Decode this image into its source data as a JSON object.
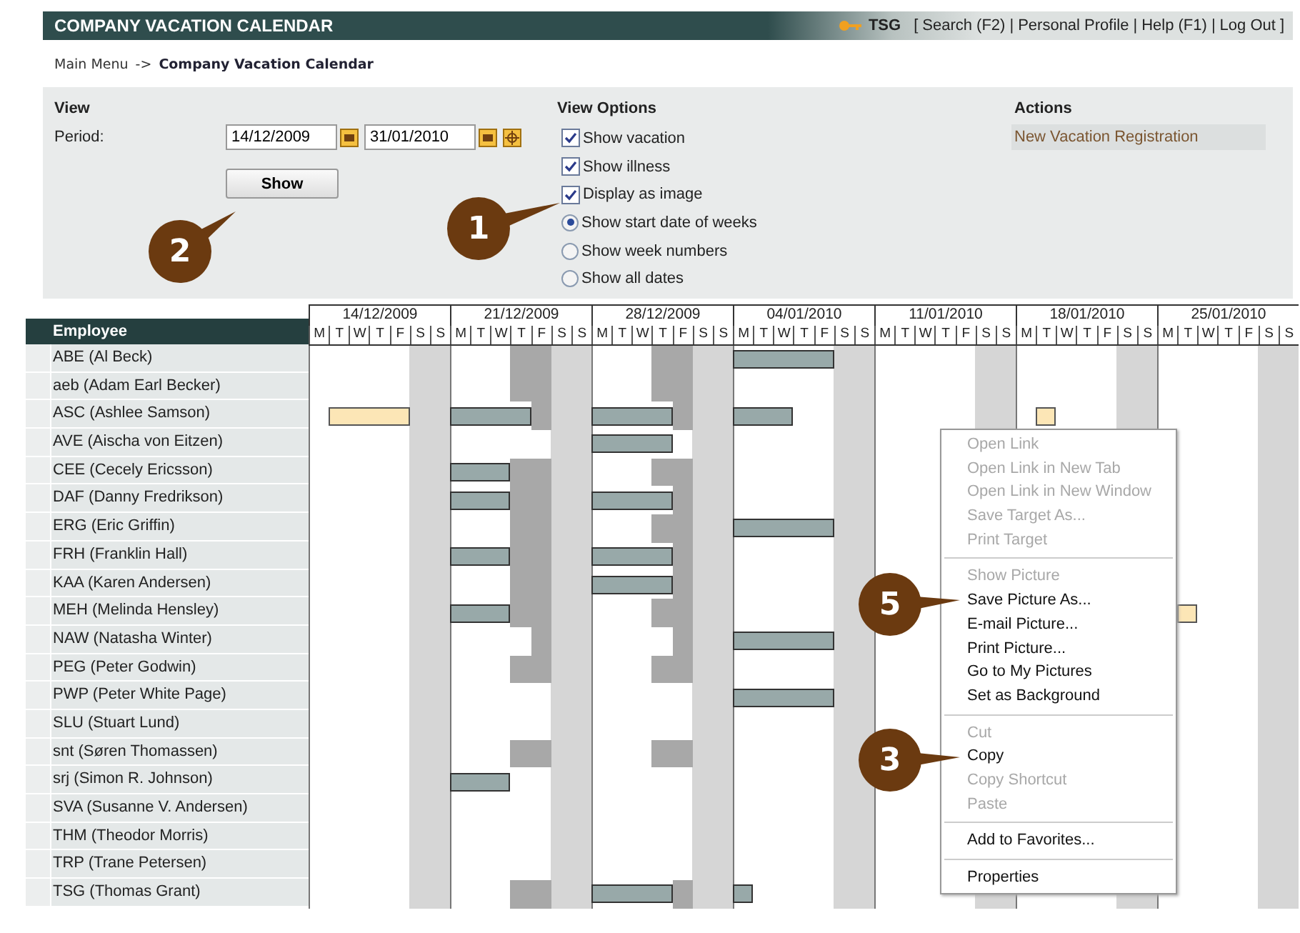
{
  "header": {
    "title": "COMPANY VACATION CALENDAR",
    "user": "TSG",
    "open": "[",
    "close": "]",
    "separator": "|",
    "links": [
      "Search (F2)",
      "Personal Profile",
      "Help (F1)",
      "Log Out"
    ]
  },
  "breadcrumb": {
    "parent": "Main Menu",
    "arrow": "->",
    "current": "Company Vacation Calendar"
  },
  "view": {
    "heading": "View",
    "period_label": "Period:",
    "from": "14/12/2009",
    "to": "31/01/2010",
    "show_button": "Show"
  },
  "view_options": {
    "heading": "View Options",
    "checkboxes": [
      {
        "label": "Show vacation",
        "checked": true
      },
      {
        "label": "Show illness",
        "checked": true
      },
      {
        "label": "Display as image",
        "checked": true
      }
    ],
    "radios": [
      {
        "label": "Show start date of weeks",
        "selected": true
      },
      {
        "label": "Show week numbers",
        "selected": false
      },
      {
        "label": "Show all dates",
        "selected": false
      }
    ]
  },
  "actions": {
    "heading": "Actions",
    "items": [
      "New Vacation Registration"
    ]
  },
  "calendar": {
    "employee_heading": "Employee",
    "weeks": [
      {
        "date": "14/12/2009",
        "days": [
          "M",
          "T",
          "W",
          "T",
          "F",
          "S",
          "S"
        ]
      },
      {
        "date": "21/12/2009",
        "days": [
          "M",
          "T",
          "W",
          "T",
          "F",
          "S",
          "S"
        ]
      },
      {
        "date": "28/12/2009",
        "days": [
          "M",
          "T",
          "W",
          "T",
          "F",
          "S",
          "S"
        ]
      },
      {
        "date": "04/01/2010",
        "days": [
          "M",
          "T",
          "W",
          "T",
          "F",
          "S",
          "S"
        ]
      },
      {
        "date": "11/01/2010",
        "days": [
          "M",
          "T",
          "W",
          "T",
          "F",
          "S",
          "S"
        ]
      },
      {
        "date": "18/01/2010",
        "days": [
          "M",
          "T",
          "W",
          "T",
          "F",
          "S",
          "S"
        ]
      },
      {
        "date": "25/01/2010",
        "days": [
          "M",
          "T",
          "W",
          "T",
          "F",
          "S",
          "S"
        ]
      }
    ],
    "rows": [
      {
        "name": "ABE (Al Beck)"
      },
      {
        "name": "aeb (Adam Earl Becker)"
      },
      {
        "name": "ASC (Ashlee Samson)"
      },
      {
        "name": "AVE (Aischa von Eitzen)"
      },
      {
        "name": "CEE (Cecely Ericsson)"
      },
      {
        "name": "DAF (Danny Fredrikson)"
      },
      {
        "name": "ERG (Eric Griffin)"
      },
      {
        "name": "FRH (Franklin Hall)"
      },
      {
        "name": "KAA (Karen Andersen)"
      },
      {
        "name": "MEH (Melinda Hensley)"
      },
      {
        "name": "NAW (Natasha Winter)"
      },
      {
        "name": "PEG (Peter Godwin)"
      },
      {
        "name": "PWP (Peter White Page)"
      },
      {
        "name": "SLU (Stuart Lund)"
      },
      {
        "name": "snt (Søren Thomassen)"
      },
      {
        "name": "srj (Simon R. Johnson)"
      },
      {
        "name": "SVA (Susanne V. Andersen)"
      },
      {
        "name": "THM (Theodor Morris)"
      },
      {
        "name": "TRP (Trane Petersen)"
      },
      {
        "name": "TSG (Thomas Grant)"
      }
    ]
  },
  "context_menu": {
    "groups": [
      [
        {
          "label": "Open Link",
          "disabled": true
        },
        {
          "label": "Open Link in New Tab",
          "disabled": true
        },
        {
          "label": "Open Link in New Window",
          "disabled": true
        },
        {
          "label": "Save Target As...",
          "disabled": true
        },
        {
          "label": "Print Target",
          "disabled": true
        }
      ],
      [
        {
          "label": "Show Picture",
          "disabled": true
        },
        {
          "label": "Save Picture As...",
          "disabled": false
        },
        {
          "label": "E-mail Picture...",
          "disabled": false
        },
        {
          "label": "Print Picture...",
          "disabled": false
        },
        {
          "label": "Go to My Pictures",
          "disabled": false
        },
        {
          "label": "Set as Background",
          "disabled": false
        }
      ],
      [
        {
          "label": "Cut",
          "disabled": true
        },
        {
          "label": "Copy",
          "disabled": false
        },
        {
          "label": "Copy Shortcut",
          "disabled": true
        },
        {
          "label": "Paste",
          "disabled": true
        }
      ],
      [
        {
          "label": "Add to Favorites...",
          "disabled": false
        }
      ],
      [
        {
          "label": "Properties",
          "disabled": false
        }
      ]
    ]
  },
  "callouts": [
    {
      "number": "1"
    },
    {
      "number": "2"
    },
    {
      "number": "5"
    },
    {
      "number": "3"
    }
  ]
}
